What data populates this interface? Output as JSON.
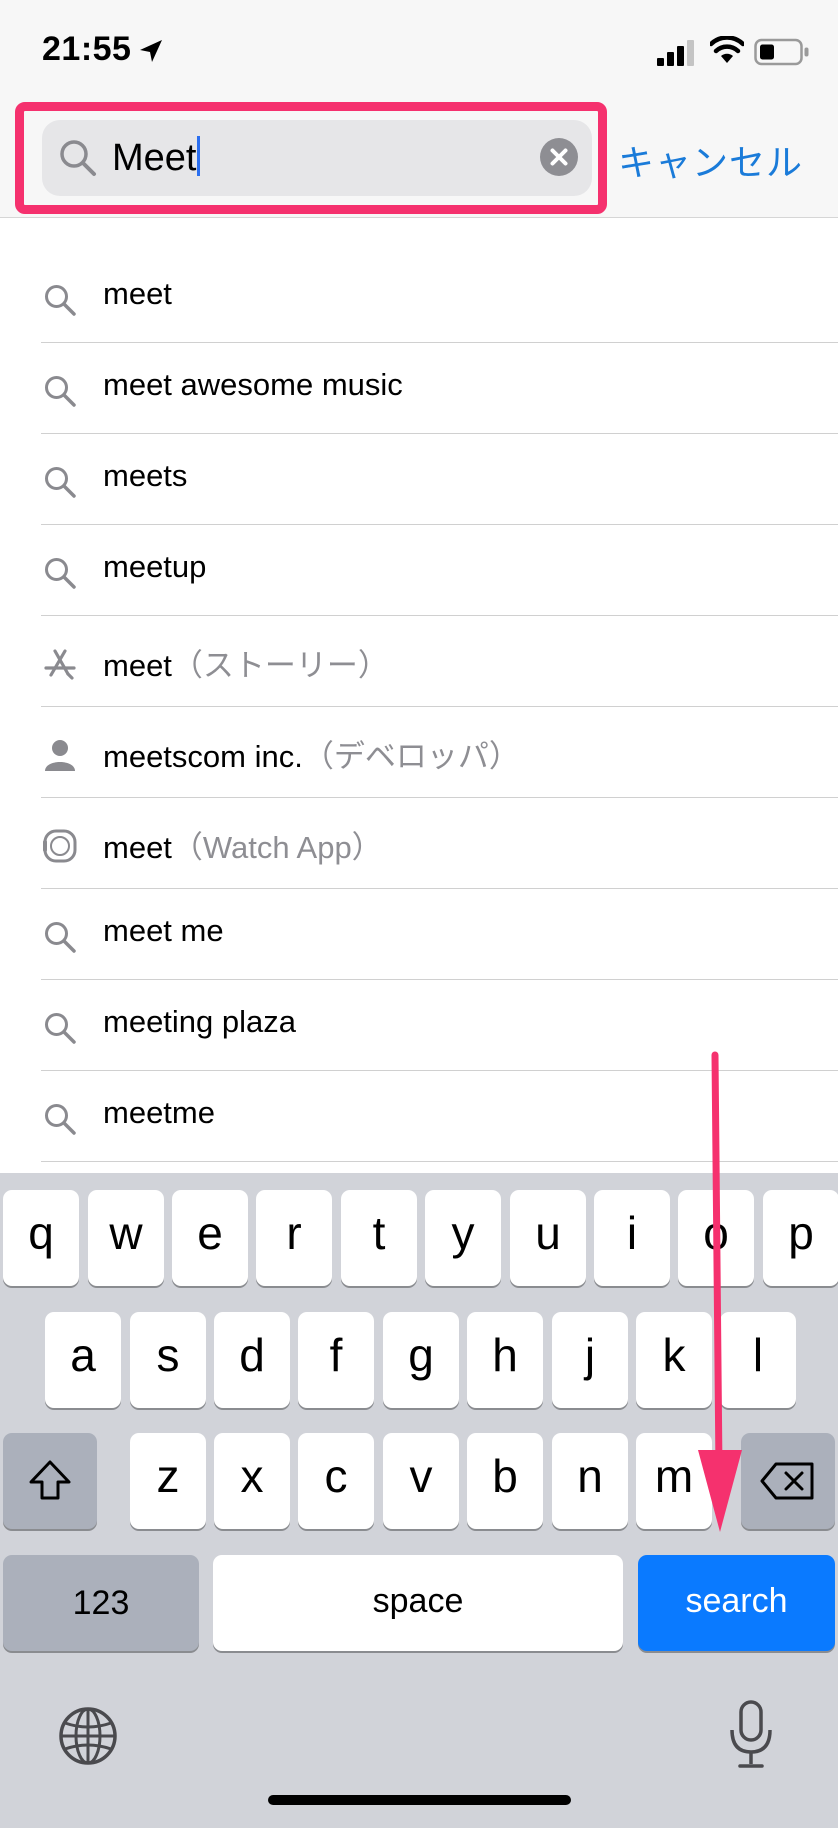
{
  "status_bar": {
    "time": "21:55"
  },
  "search": {
    "value": "Meet",
    "cancel_label": "キャンセル"
  },
  "suggestions": [
    {
      "icon": "search-icon",
      "text": "meet",
      "tag": ""
    },
    {
      "icon": "search-icon",
      "text": "meet awesome music",
      "tag": ""
    },
    {
      "icon": "search-icon",
      "text": "meets",
      "tag": ""
    },
    {
      "icon": "search-icon",
      "text": "meetup",
      "tag": ""
    },
    {
      "icon": "app-store-icon",
      "text": "meet",
      "tag": "（ストーリー）"
    },
    {
      "icon": "person-icon",
      "text": "meetscom inc.",
      "tag": "（デベロッパ）"
    },
    {
      "icon": "watch-icon",
      "text": "meet",
      "tag": "（Watch App）"
    },
    {
      "icon": "search-icon",
      "text": "meet me",
      "tag": ""
    },
    {
      "icon": "search-icon",
      "text": "meeting plaza",
      "tag": ""
    },
    {
      "icon": "search-icon",
      "text": "meetme",
      "tag": ""
    }
  ],
  "keyboard": {
    "row1": [
      "q",
      "w",
      "e",
      "r",
      "t",
      "y",
      "u",
      "i",
      "o",
      "p"
    ],
    "row2": [
      "a",
      "s",
      "d",
      "f",
      "g",
      "h",
      "j",
      "k",
      "l"
    ],
    "row3": [
      "z",
      "x",
      "c",
      "v",
      "b",
      "n",
      "m"
    ],
    "numbers_label": "123",
    "space_label": "space",
    "search_label": "search",
    "search_color": "#0a7aff"
  },
  "colors": {
    "highlight": "#f5316e",
    "accent": "#1a7bd9"
  }
}
